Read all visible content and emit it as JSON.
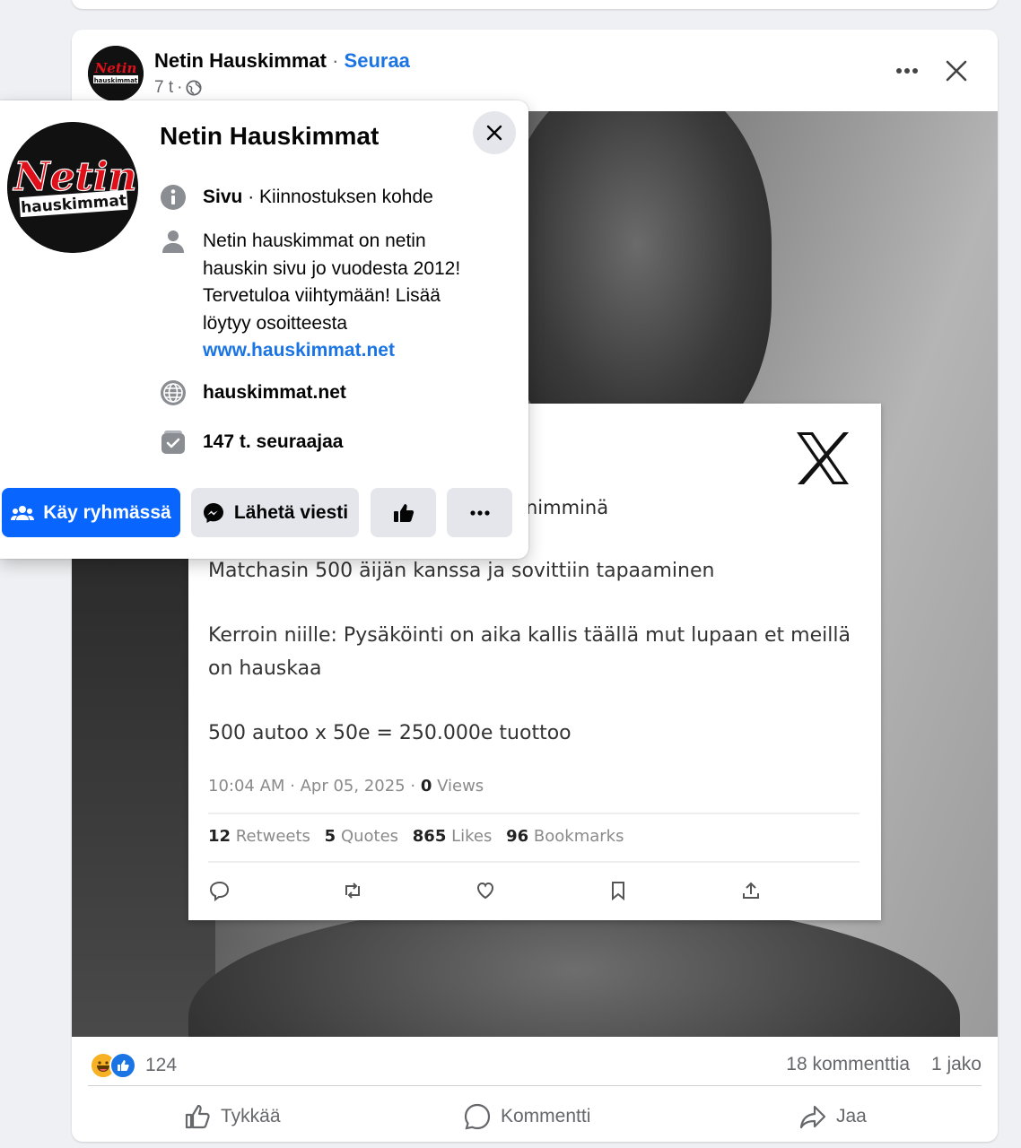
{
  "post": {
    "page_name": "Netin Hauskimmat",
    "separator": "·",
    "follow_label": "Seuraa",
    "time": "7 t",
    "time_separator": "·",
    "logo_text_top": "Netin",
    "logo_text_bottom": "hauskimmat"
  },
  "tweet": {
    "partial_text": "nimminä",
    "line1": "Matchasin 500 äijän kanssa ja sovittiin tapaaminen",
    "line2a": "Kerroin niille: Pysäköinti on aika kallis täällä mut lupaan et meillä",
    "line2b": "on hauskaa",
    "line3": "500 autoo x 50e = 250.000e tuottoo",
    "timestamp": "10:04 AM · Apr 05, 2025 ·",
    "views_count": "0",
    "views_label": "Views",
    "retweets_count": "12",
    "retweets_label": "Retweets",
    "quotes_count": "5",
    "quotes_label": "Quotes",
    "likes_count": "865",
    "likes_label": "Likes",
    "bookmarks_count": "96",
    "bookmarks_label": "Bookmarks"
  },
  "footer": {
    "reaction_count": "124",
    "comments": "18 kommenttia",
    "shares": "1 jako",
    "like_label": "Tykkää",
    "comment_label": "Kommentti",
    "share_label": "Jaa"
  },
  "popup": {
    "title": "Netin Hauskimmat",
    "type_bold": "Sivu",
    "type_rest": " · Kiinnostuksen kohde",
    "about_lines": [
      "Netin hauskimmat on netin",
      "hauskin sivu jo vuodesta 2012!",
      "Tervetuloa viihtymään! Lisää",
      "löytyy osoitteesta"
    ],
    "about_link": "www.hauskimmat.net",
    "website": "hauskimmat.net",
    "followers": "147 t. seuraajaa",
    "join_group_label": "Käy ryhmässä",
    "message_label": "Lähetä viesti"
  },
  "colors": {
    "accent": "#1b74e4",
    "primary_button": "#0866ff",
    "secondary_button": "#e4e6eb",
    "muted_text": "#65676b"
  },
  "icons": [
    "info-icon",
    "person-icon",
    "globe-icon",
    "followers-icon",
    "group-icon",
    "messenger-icon",
    "thumbs-up-icon",
    "more-icon",
    "close-icon",
    "x-logo-icon",
    "reply-icon",
    "retweet-icon",
    "heart-icon",
    "bookmark-icon",
    "share-icon",
    "like-icon",
    "comment-icon",
    "share-arrow-icon",
    "haha-reaction-icon",
    "like-reaction-icon"
  ]
}
